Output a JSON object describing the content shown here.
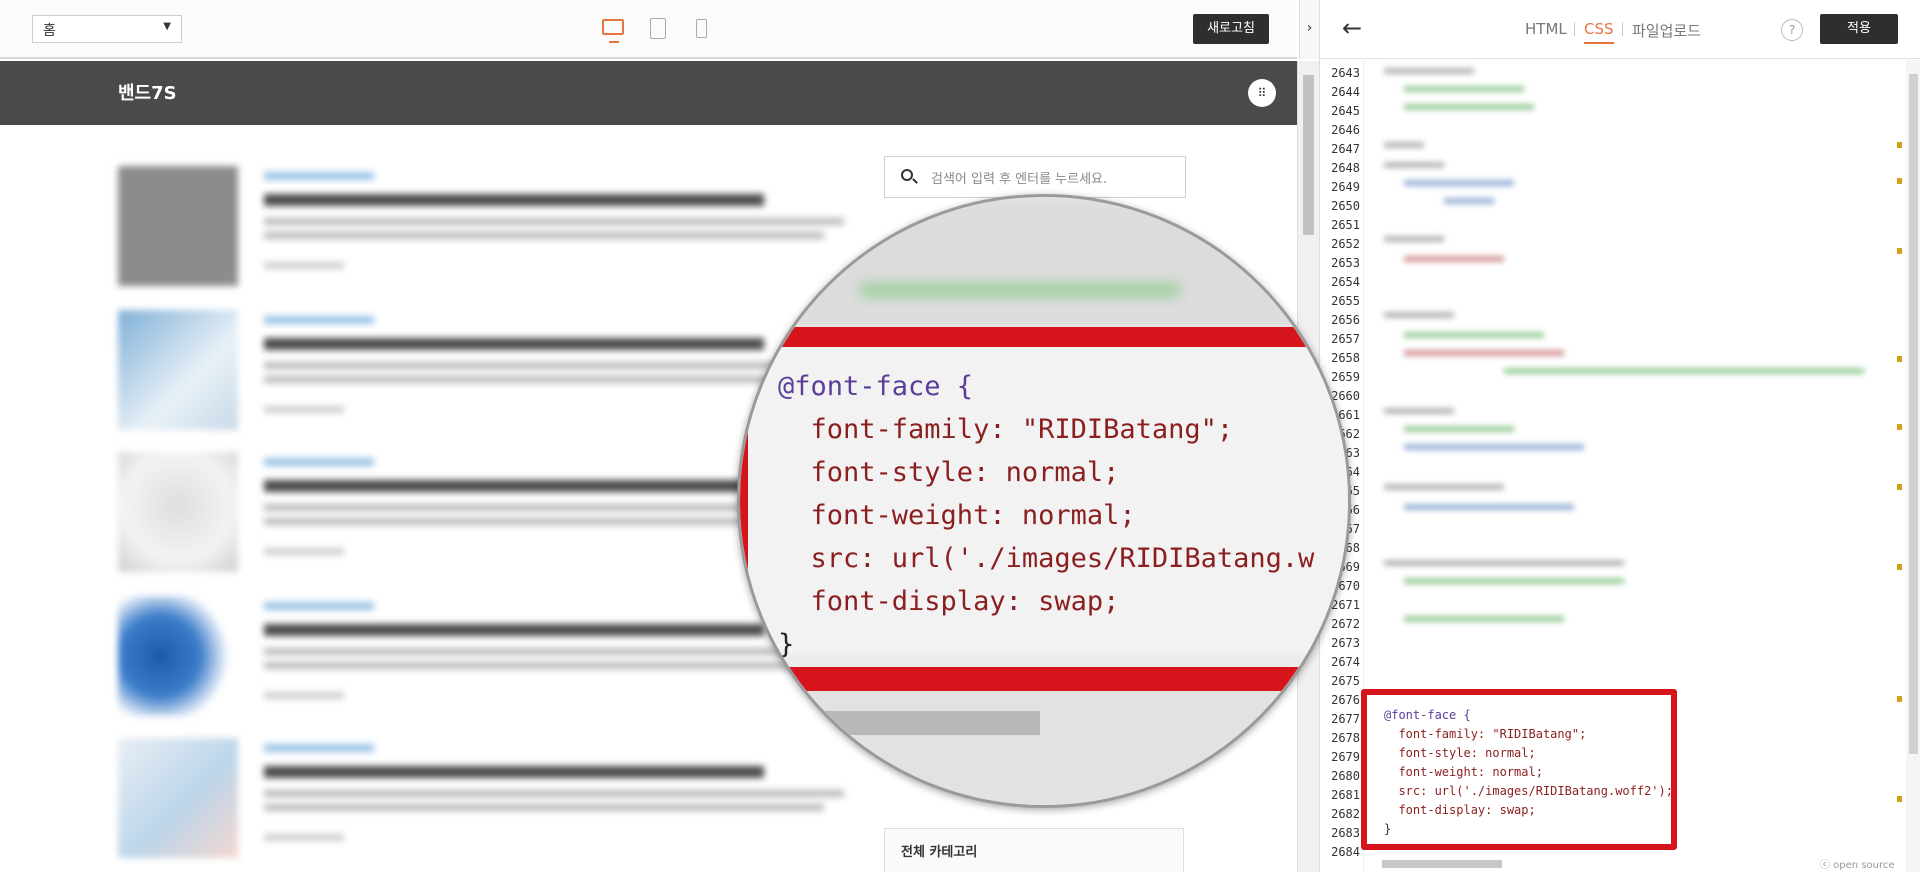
{
  "left_pane": {
    "page_select": {
      "value": "홈"
    },
    "refresh_label": "새로고침",
    "site_title": "밴드7S",
    "search": {
      "placeholder": "검색어 입력 후 엔터를 누르세요."
    },
    "category_box": {
      "title": "전체 카테고리"
    }
  },
  "right_pane": {
    "tabs": [
      {
        "label": "HTML",
        "active": false
      },
      {
        "label": "CSS",
        "active": true
      },
      {
        "label": "파일업로드",
        "active": false
      }
    ],
    "help_label": "?",
    "apply_label": "적용",
    "line_numbers": [
      "2643",
      "2644",
      "2645",
      "2646",
      "2647",
      "2648",
      "2649",
      "2650",
      "2651",
      "2652",
      "2653",
      "2654",
      "2655",
      "2656",
      "2657",
      "2658",
      "2659",
      "2660",
      "2661",
      "2662",
      "2663",
      "2664",
      "2665",
      "2666",
      "2667",
      "2668",
      "2669",
      "2670",
      "2671",
      "2672",
      "2673",
      "2674",
      "2675",
      "2676",
      "2677",
      "2678",
      "2679",
      "2680",
      "2681",
      "2682",
      "2683",
      "2684"
    ],
    "code_lines": [
      "@font-face {",
      "  font-family: \"RIDIBatang\";",
      "  font-style: normal;",
      "  font-weight: normal;",
      "  src: url('./images/RIDIBatang.woff2');",
      "  font-display: swap;",
      "}"
    ],
    "open_source_label": "ⓒ open source"
  },
  "magnifier": {
    "code_lines": [
      "@font-face {",
      "  font-family: \"RIDIBatang\";",
      "  font-style: normal;",
      "  font-weight: normal;",
      "  src: url('./images/RIDIBatang.w",
      "  font-display: swap;",
      "}"
    ]
  },
  "colors": {
    "accent": "#e5763f",
    "highlight_red": "#d6141c",
    "header_bg": "#4a4a4a",
    "button_bg": "#2e2e2e"
  },
  "icons": [
    "desktop-icon",
    "tablet-icon",
    "phone-icon",
    "chevron-right-icon",
    "back-arrow-icon",
    "help-icon",
    "search-icon",
    "menu-dots-icon"
  ]
}
